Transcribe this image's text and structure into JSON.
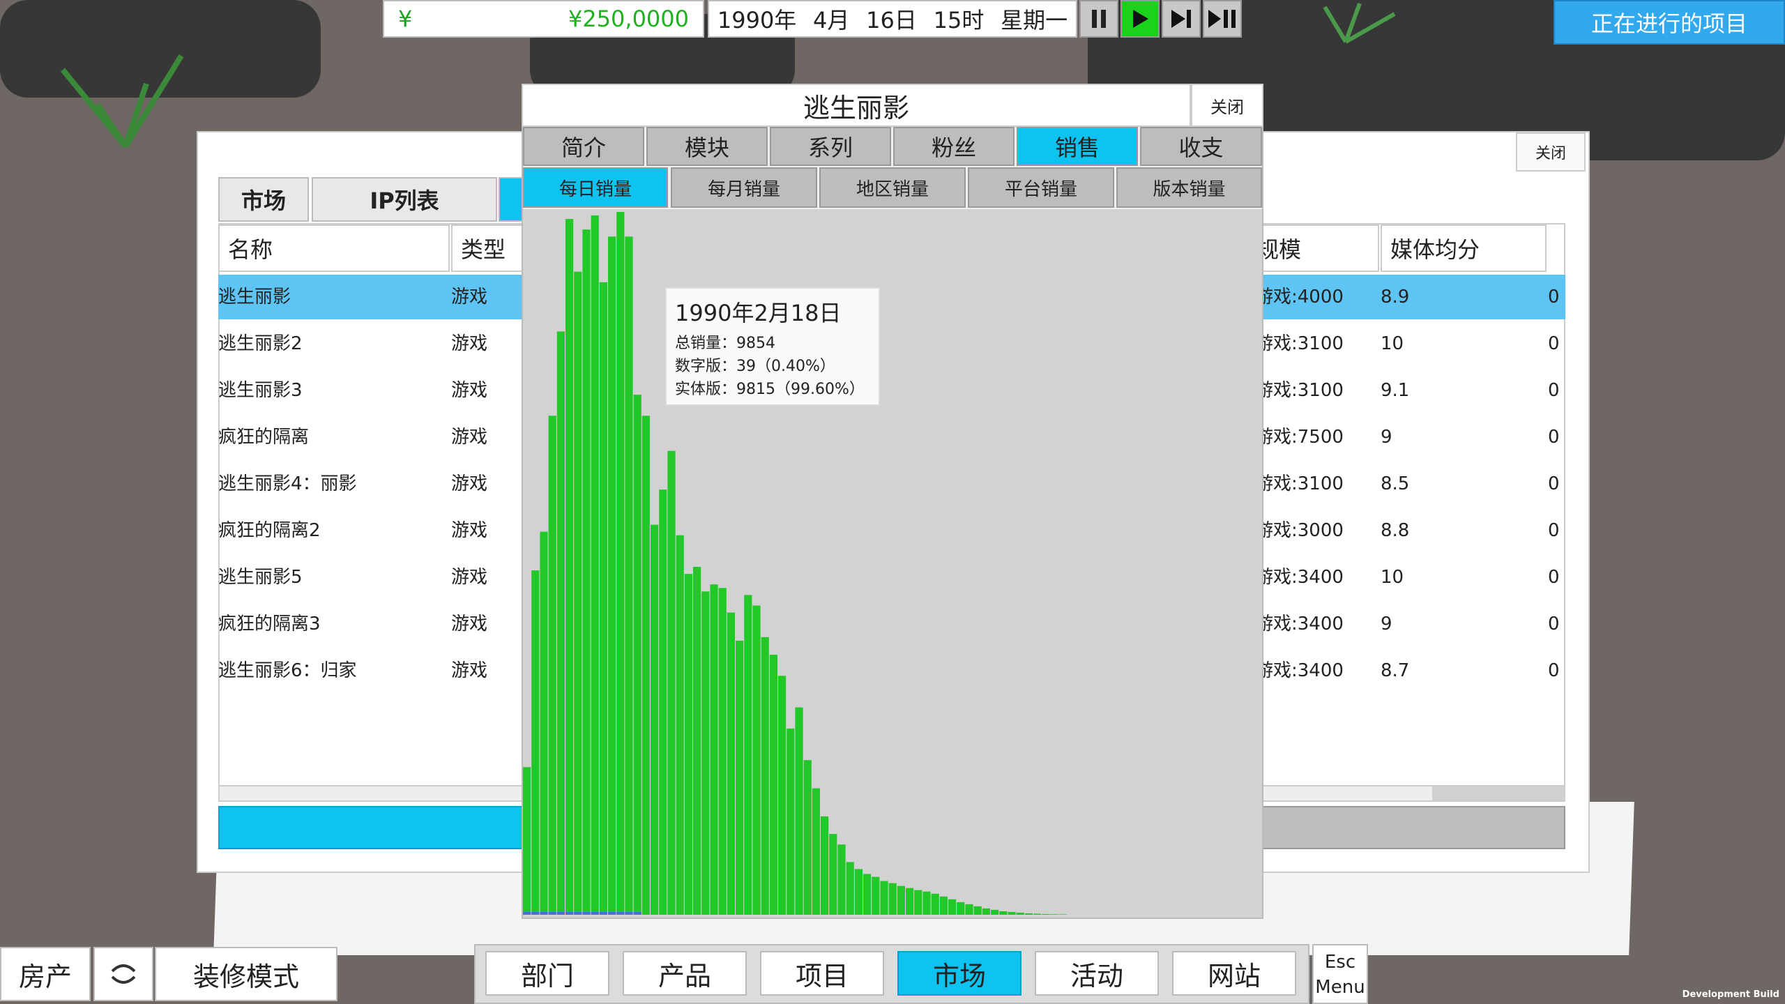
{
  "hud": {
    "currency_symbol": "¥",
    "money": "¥250,0000",
    "date": {
      "year": "1990年",
      "month": "4月",
      "day": "16日",
      "hour": "15时",
      "weekday": "星期一"
    },
    "speed_buttons": [
      "pause-icon",
      "play-icon",
      "step-icon",
      "fast-forward-icon"
    ],
    "ongoing_projects": "正在进行的项目"
  },
  "market": {
    "tabs": [
      "市场",
      "IP列表"
    ],
    "close": "关闭",
    "columns": {
      "name": "名称",
      "type": "类型",
      "scale": "规模",
      "media_score": "媒体均分"
    },
    "rows": [
      {
        "name": "逃生丽影",
        "type": "游戏",
        "scale": "游戏:4000",
        "score": "8.9",
        "extra": "0"
      },
      {
        "name": "逃生丽影2",
        "type": "游戏",
        "scale": "游戏:3100",
        "score": "10",
        "extra": "0"
      },
      {
        "name": "逃生丽影3",
        "type": "游戏",
        "scale": "游戏:3100",
        "score": "9.1",
        "extra": "0"
      },
      {
        "name": "疯狂的隔离",
        "type": "游戏",
        "scale": "游戏:7500",
        "score": "9",
        "extra": "0"
      },
      {
        "name": "逃生丽影4：丽影",
        "type": "游戏",
        "scale": "游戏:3100",
        "score": "8.5",
        "extra": "0"
      },
      {
        "name": "疯狂的隔离2",
        "type": "游戏",
        "scale": "游戏:3000",
        "score": "8.8",
        "extra": "0"
      },
      {
        "name": "逃生丽影5",
        "type": "游戏",
        "scale": "游戏:3400",
        "score": "10",
        "extra": "0"
      },
      {
        "name": "疯狂的隔离3",
        "type": "游戏",
        "scale": "游戏:3400",
        "score": "9",
        "extra": "0"
      },
      {
        "name": "逃生丽影6：归家",
        "type": "游戏",
        "scale": "游戏:3400",
        "score": "8.7",
        "extra": "0"
      }
    ]
  },
  "sales": {
    "title": "逃生丽影",
    "close": "关闭",
    "tabs": [
      "简介",
      "模块",
      "系列",
      "粉丝",
      "销售",
      "收支"
    ],
    "active_tab": 4,
    "subtabs": [
      "每日销量",
      "每月销量",
      "地区销量",
      "平台销量",
      "版本销量"
    ],
    "active_subtab": 0,
    "tooltip": {
      "date": "1990年2月18日",
      "total": "总销量：9854",
      "digital": "数字版：39（0.40%）",
      "physical": "实体版：9815（99.60%）"
    }
  },
  "chart_data": {
    "type": "bar",
    "ylim": [
      0,
      10000
    ],
    "colors": {
      "physical": "#22c728",
      "digital": "#4a6fd0"
    },
    "series": [
      {
        "values": [
          2100,
          4900,
          5450,
          7100,
          8300,
          9900,
          9150,
          9750,
          9950,
          9000,
          9650,
          10000,
          9650,
          7400,
          7100,
          5550,
          6050,
          6600,
          5400,
          4850,
          4950,
          4600,
          4700,
          4650,
          4300,
          3900,
          4550,
          4400,
          3950,
          3700,
          3400,
          2650,
          2950,
          2200,
          1800,
          1400,
          1150,
          1000,
          750,
          650,
          580,
          540,
          480,
          450,
          410,
          380,
          350,
          330,
          300,
          260,
          220,
          180,
          150,
          120,
          90,
          70,
          50,
          40,
          30,
          20,
          15,
          10,
          8,
          6
        ]
      }
    ]
  },
  "toolbar": {
    "property": "房产",
    "decorate": "装修模式",
    "nav": [
      "部门",
      "产品",
      "项目",
      "市场",
      "活动",
      "网站"
    ],
    "active_nav": 3,
    "esc": "Esc",
    "menu": "Menu"
  },
  "watermark": "Development Build"
}
